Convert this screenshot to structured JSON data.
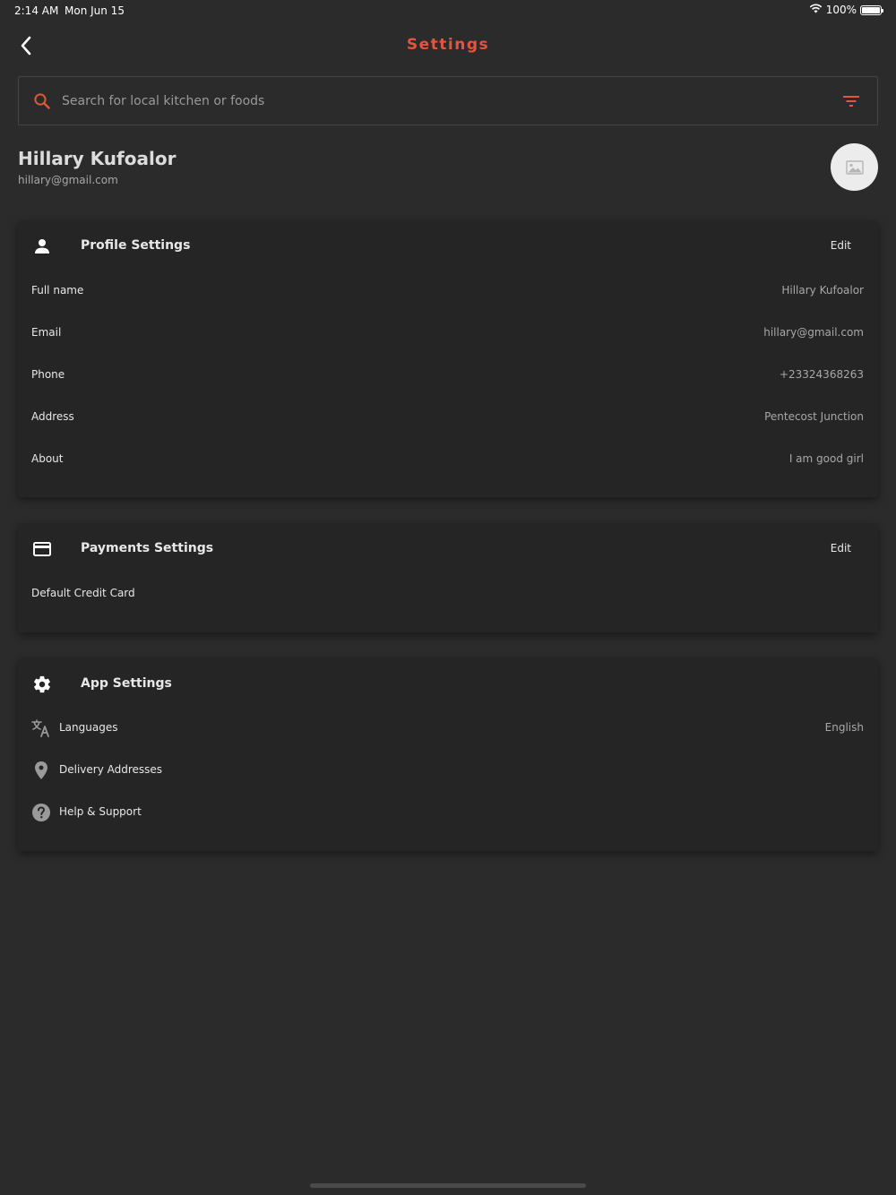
{
  "status_bar": {
    "time": "2:14 AM",
    "date": "Mon Jun 15",
    "battery": "100%"
  },
  "header": {
    "title": "Settings"
  },
  "search": {
    "placeholder": "Search for local kitchen or foods"
  },
  "user": {
    "name": "Hillary Kufoalor",
    "email": "hillary@gmail.com"
  },
  "profile_settings": {
    "title": "Profile Settings",
    "edit_label": "Edit",
    "rows": [
      {
        "label": "Full name",
        "value": "Hillary Kufoalor"
      },
      {
        "label": "Email",
        "value": "hillary@gmail.com"
      },
      {
        "label": "Phone",
        "value": "+23324368263"
      },
      {
        "label": "Address",
        "value": "Pentecost Junction"
      },
      {
        "label": "About",
        "value": "I am good girl"
      }
    ]
  },
  "payment_settings": {
    "title": "Payments Settings",
    "edit_label": "Edit",
    "rows": [
      {
        "label": "Default Credit Card"
      }
    ]
  },
  "app_settings": {
    "title": "App Settings",
    "rows": [
      {
        "label": "Languages",
        "value": "English",
        "icon": "translate-icon"
      },
      {
        "label": "Delivery Addresses",
        "icon": "location-pin-icon"
      },
      {
        "label": "Help & Support",
        "icon": "help-icon"
      }
    ]
  },
  "colors": {
    "accent": "#e0573b",
    "background": "#2b2b2b",
    "card": "#252525",
    "icon_gray": "#9a9a9a"
  }
}
